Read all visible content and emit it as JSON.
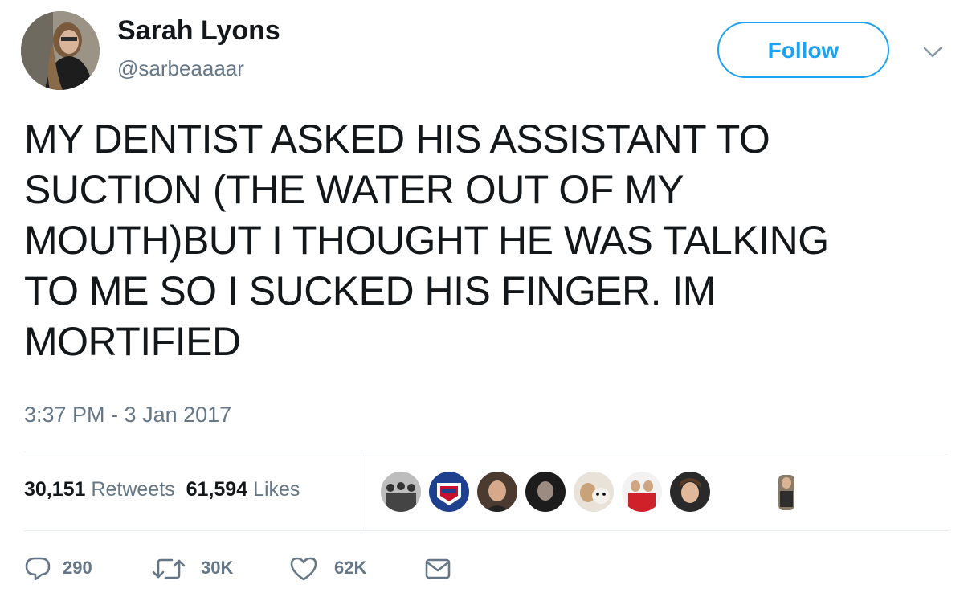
{
  "user": {
    "display_name": "Sarah Lyons",
    "handle": "@sarbeaaaar",
    "follow_label": "Follow"
  },
  "tweet": {
    "lines": [
      "MY DENTIST ASKED HIS ASSISTANT TO",
      "SUCTION (THE WATER OUT OF MY",
      "MOUTH)BUT I THOUGHT HE WAS TALKING",
      "TO ME SO I SUCKED HIS FINGER. IM",
      "MORTIFIED"
    ],
    "timestamp": "3:37 PM - 3 Jan 2017"
  },
  "stats": {
    "retweets_count": "30,151",
    "retweets_label": "Retweets",
    "likes_count": "61,594",
    "likes_label": "Likes"
  },
  "actions": {
    "reply_count": "290",
    "retweet_count": "30K",
    "like_count": "62K"
  },
  "icons": {
    "menu": "chevron-down-icon",
    "reply": "reply-icon",
    "retweet": "retweet-icon",
    "like": "heart-icon",
    "message": "envelope-icon"
  },
  "colors": {
    "accent": "#1da1f2",
    "text": "#14171a",
    "muted": "#657786",
    "divider": "#e6ecf0"
  }
}
